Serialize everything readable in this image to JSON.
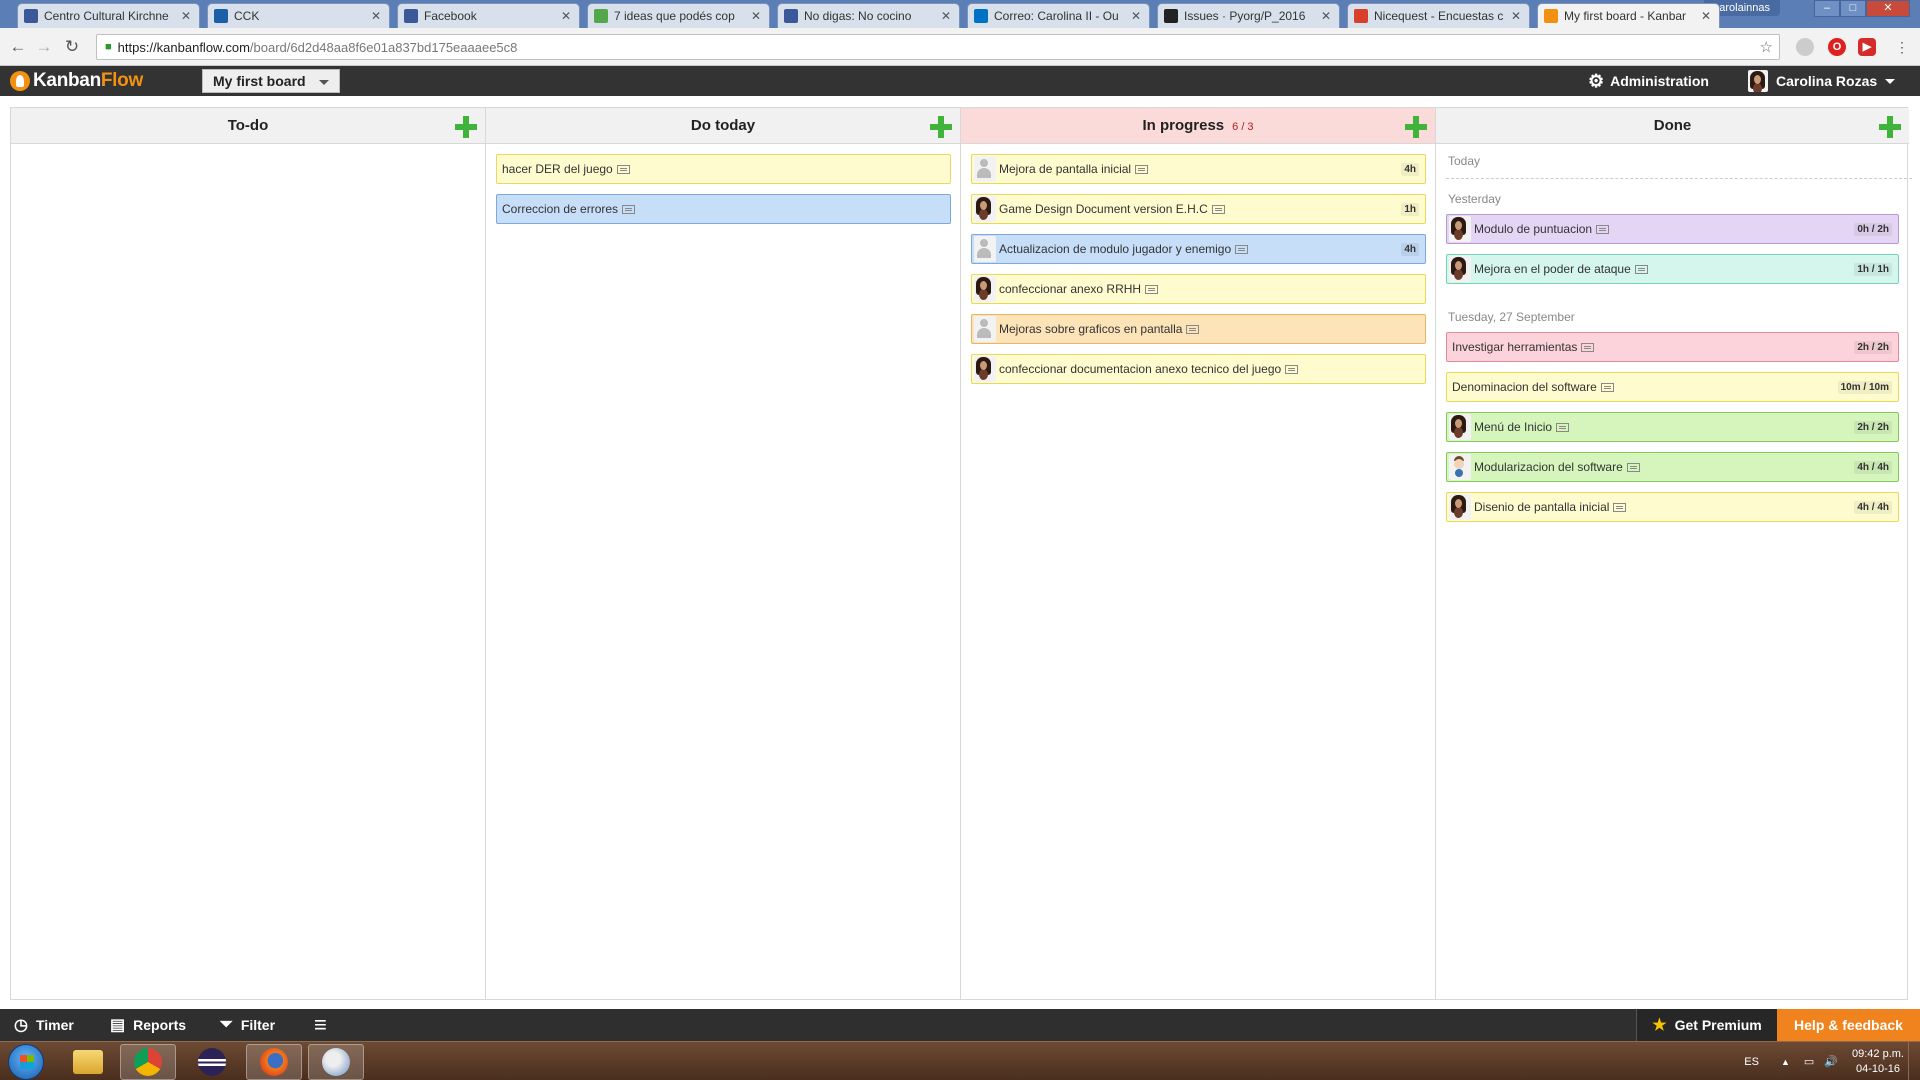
{
  "browser": {
    "tabs": [
      {
        "title": "Centro Cultural Kirchne",
        "favicon": "facebook-icon",
        "color": "#3b5998"
      },
      {
        "title": "CCK",
        "favicon": "cck-icon",
        "color": "#1b5fa8"
      },
      {
        "title": "Facebook",
        "favicon": "facebook-icon",
        "color": "#3b5998"
      },
      {
        "title": "7 ideas que podés cop",
        "favicon": "document-icon",
        "color": "#52a84a"
      },
      {
        "title": "No digas: No cocino",
        "favicon": "facebook-icon",
        "color": "#3b5998"
      },
      {
        "title": "Correo: Carolina II - Ou",
        "favicon": "outlook-icon",
        "color": "#0072c6"
      },
      {
        "title": "Issues · Pyorg/P_2016",
        "favicon": "github-icon",
        "color": "#222222"
      },
      {
        "title": "Nicequest - Encuestas c",
        "favicon": "nicequest-icon",
        "color": "#d9402b"
      },
      {
        "title": "My first board - Kanbar",
        "favicon": "kanbanflow-icon",
        "color": "#f29111"
      }
    ],
    "window_user": "carolainnas",
    "url_host": "https://kanbanflow.com",
    "url_path": "/board/6d2d48aa8f6e01a837bd175eaaaee5c8"
  },
  "app": {
    "logo_part1": "Kanban",
    "logo_part2": "Flow",
    "board_name": "My first board",
    "admin_label": "Administration",
    "user_name": "Carolina Rozas"
  },
  "columns": [
    {
      "name": "To-do",
      "tasks": []
    },
    {
      "name": "Do today",
      "tasks": [
        {
          "name": "hacer DER del juego",
          "color": "yellow",
          "avatar": "",
          "time": ""
        },
        {
          "name": "Correccion de errores",
          "color": "blue",
          "avatar": "",
          "time": ""
        }
      ]
    },
    {
      "name": "In progress",
      "wip": "6 / 3",
      "tasks": [
        {
          "name": "Mejora de pantalla inicial",
          "color": "yellow",
          "avatar": "generic",
          "time": "4h"
        },
        {
          "name": "Game Design Document version E.H.C",
          "color": "yellow",
          "avatar": "female",
          "time": "1h"
        },
        {
          "name": "Actualizacion de modulo jugador y enemigo",
          "color": "blue",
          "avatar": "generic",
          "time": "4h"
        },
        {
          "name": "confeccionar anexo RRHH",
          "color": "yellow",
          "avatar": "female",
          "time": ""
        },
        {
          "name": "Mejoras sobre graficos en pantalla",
          "color": "orange",
          "avatar": "generic",
          "time": ""
        },
        {
          "name": "confeccionar documentacion anexo tecnico del juego",
          "color": "yellow",
          "avatar": "female",
          "time": ""
        }
      ]
    },
    {
      "name": "Done",
      "groups": [
        {
          "label": "Today",
          "tasks": []
        },
        {
          "label": "Yesterday",
          "tasks": [
            {
              "name": "Modulo de puntuacion",
              "color": "purple",
              "avatar": "female",
              "time": "0h / 2h"
            },
            {
              "name": "Mejora en el poder de ataque",
              "color": "teal",
              "avatar": "female",
              "time": "1h / 1h"
            }
          ]
        },
        {
          "label": "Tuesday, 27 September",
          "tasks": [
            {
              "name": "Investigar herramientas",
              "color": "red",
              "avatar": "",
              "time": "2h / 2h"
            },
            {
              "name": "Denominacion del software",
              "color": "yellow",
              "avatar": "",
              "time": "10m / 10m"
            },
            {
              "name": "Menú de Inicio",
              "color": "green",
              "avatar": "female",
              "time": "2h / 2h"
            },
            {
              "name": "Modularizacion del software",
              "color": "green",
              "avatar": "male",
              "time": "4h / 4h"
            },
            {
              "name": "Disenio de pantalla inicial",
              "color": "yellow",
              "avatar": "female",
              "time": "4h / 4h"
            }
          ]
        }
      ]
    }
  ],
  "toolbar": {
    "timer": "Timer",
    "reports": "Reports",
    "filter": "Filter",
    "get_premium": "Get Premium",
    "help": "Help & feedback"
  },
  "taskbar": {
    "lang": "ES",
    "time": "09:42 p.m.",
    "date": "04-10-16"
  }
}
